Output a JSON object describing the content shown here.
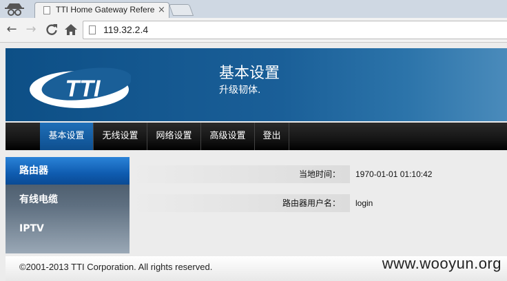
{
  "browser": {
    "tab_title": "TTI Home Gateway Refere",
    "tab_close_glyph": "×",
    "back_glyph": "←",
    "forward_glyph": "→",
    "reload_glyph": "C",
    "url": "119.32.2.4"
  },
  "banner": {
    "logo_text": "TTI",
    "title": "基本设置",
    "subtitle": "升级韧体."
  },
  "topnav": {
    "items": [
      {
        "label": "基本设置",
        "active": true
      },
      {
        "label": "无线设置",
        "active": false
      },
      {
        "label": "网络设置",
        "active": false
      },
      {
        "label": "高级设置",
        "active": false
      },
      {
        "label": "登出",
        "active": false
      }
    ]
  },
  "sidebar": {
    "items": [
      {
        "label": "路由器",
        "active": true
      },
      {
        "label": "有线电缆",
        "active": false
      },
      {
        "label": "IPTV",
        "active": false
      }
    ]
  },
  "info": {
    "rows": [
      {
        "label": "当地时间：",
        "value": "1970-01-01 01:10:42"
      },
      {
        "label": "路由器用户名：",
        "value": "login"
      }
    ]
  },
  "footer": {
    "copyright": "©2001-2013 TTI Corporation. All rights reserved."
  },
  "watermark": "www.wooyun.org",
  "colors": {
    "banner_blue": "#0d4f86",
    "nav_active": "#1f6fb8",
    "sidebar_active": "#2a83d8"
  },
  "icons": {
    "incognito": "incognito-icon",
    "favicon": "page-icon",
    "home": "home-icon"
  }
}
